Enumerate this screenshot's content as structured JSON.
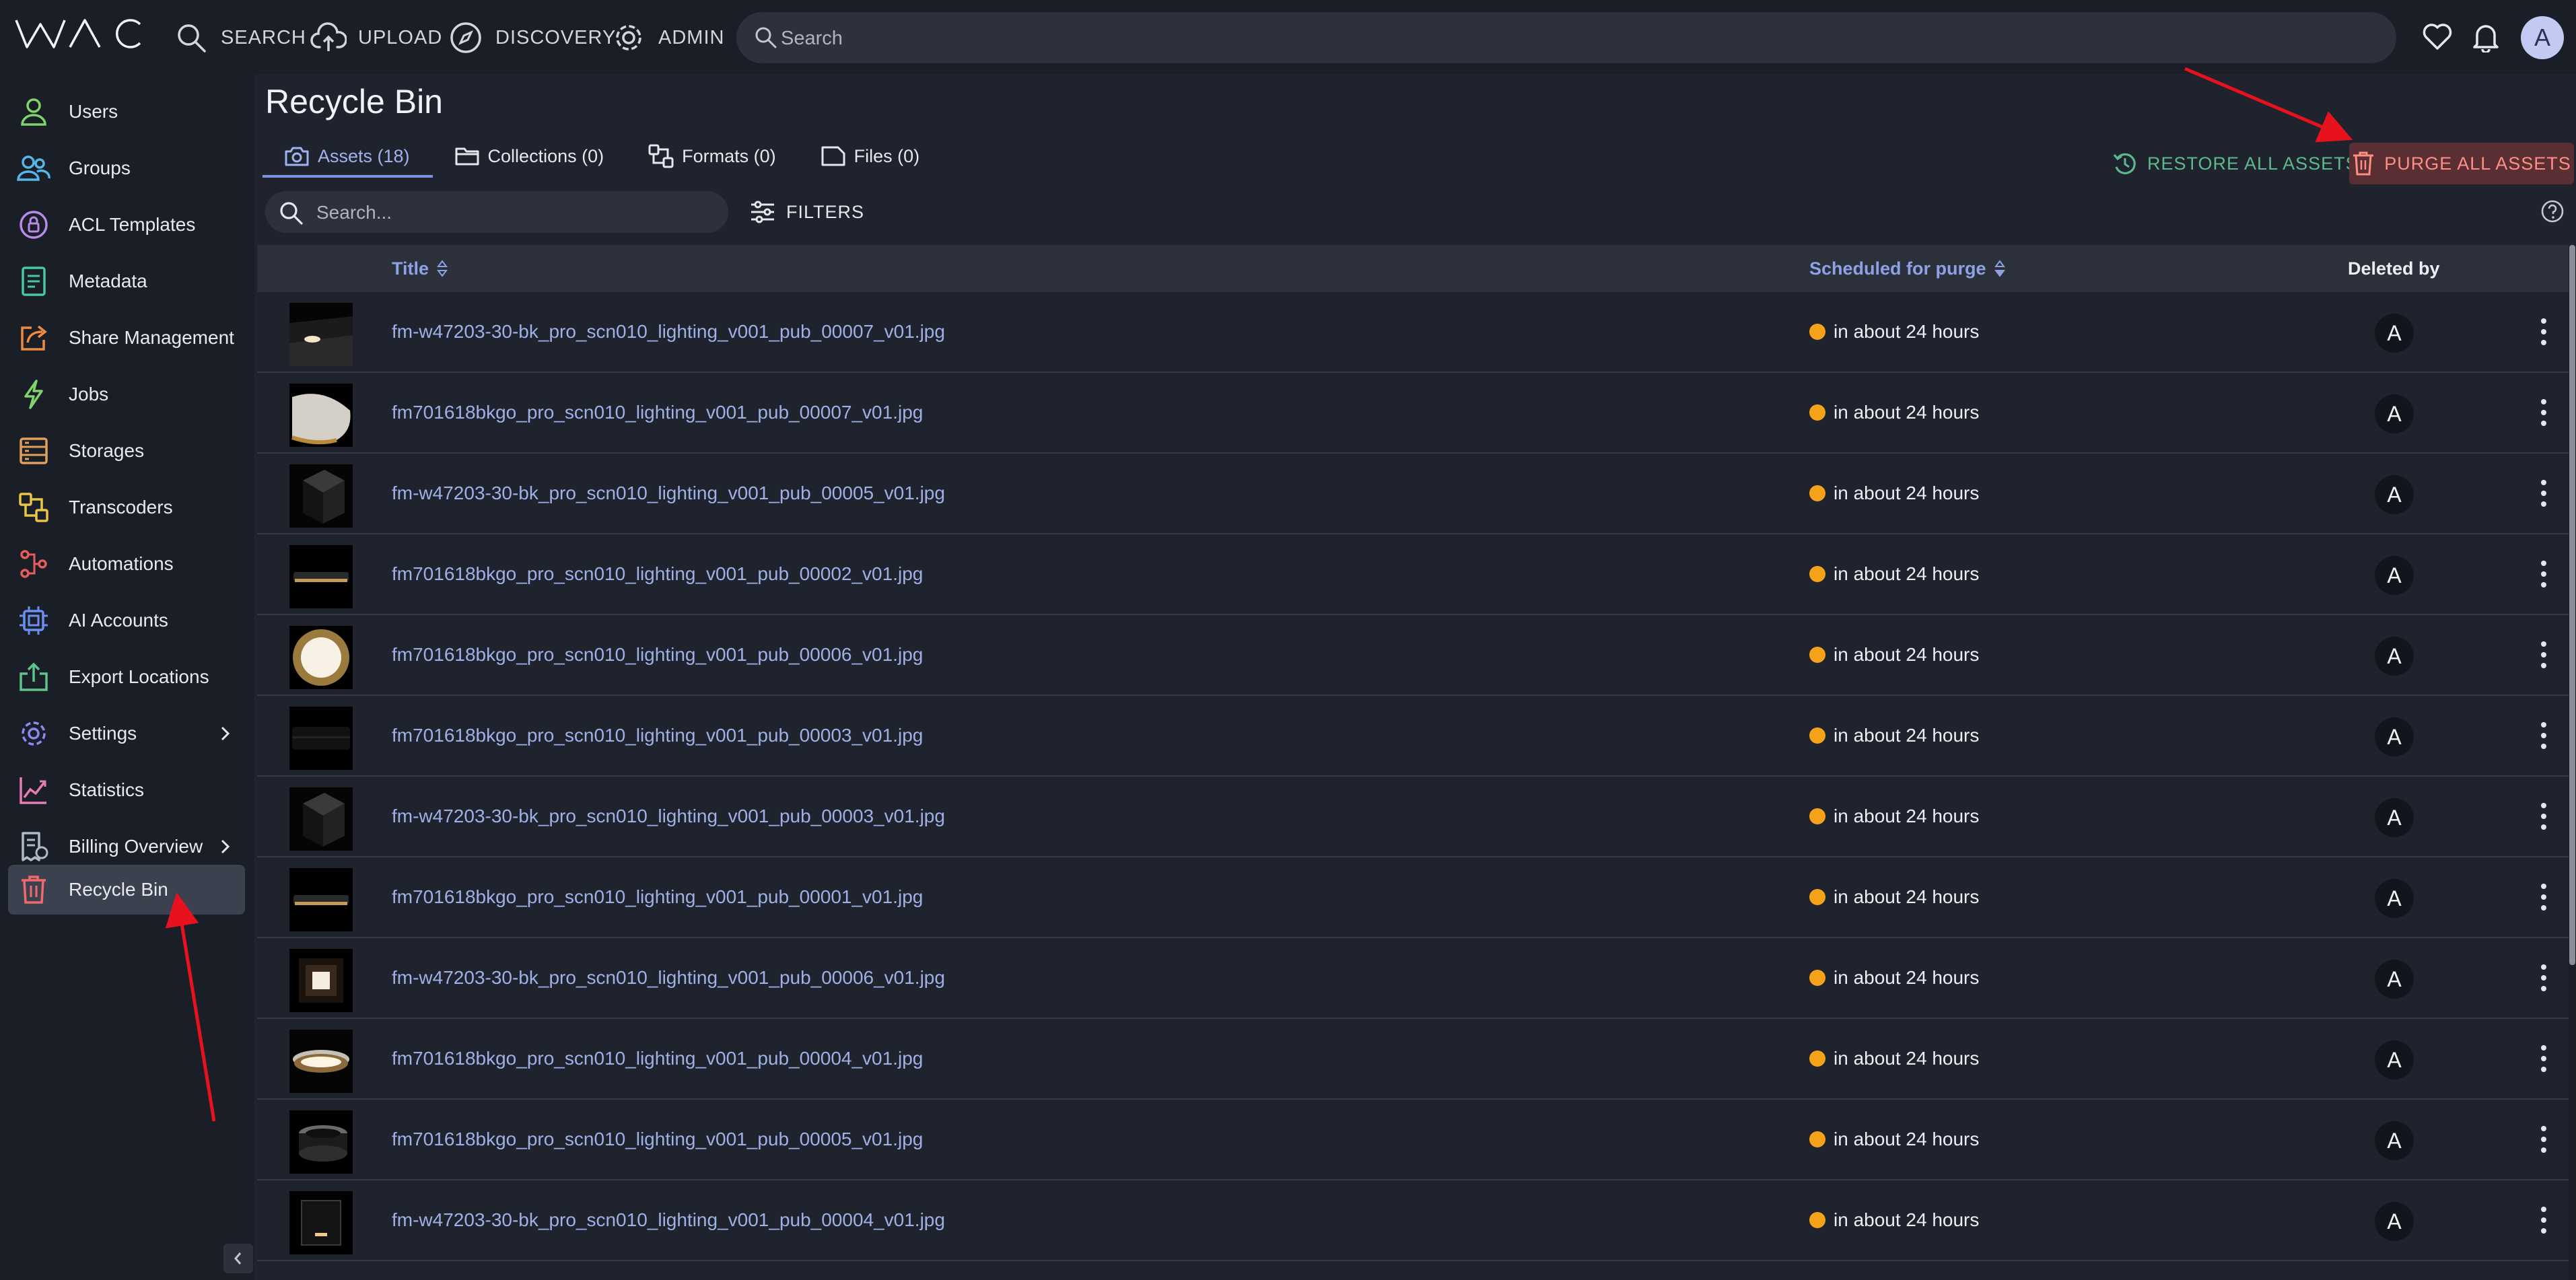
{
  "app": {
    "logo": "WAC"
  },
  "nav": [
    {
      "label": "SEARCH",
      "icon": "search-icon"
    },
    {
      "label": "UPLOAD",
      "icon": "cloud-upload-icon"
    },
    {
      "label": "DISCOVERY",
      "icon": "compass-icon"
    },
    {
      "label": "ADMIN",
      "icon": "gear-icon"
    }
  ],
  "global_search": {
    "placeholder": "Search"
  },
  "user": {
    "initial": "A"
  },
  "sidebar": {
    "items": [
      {
        "label": "Users",
        "icon": "user-icon",
        "color": "#7fd46a"
      },
      {
        "label": "Groups",
        "icon": "group-icon",
        "color": "#55b6e8"
      },
      {
        "label": "ACL Templates",
        "icon": "acl-template-icon",
        "color": "#b98be8"
      },
      {
        "label": "Metadata",
        "icon": "metadata-icon",
        "color": "#49c7a4"
      },
      {
        "label": "Share Management",
        "icon": "share-icon",
        "color": "#f08a3c"
      },
      {
        "label": "Jobs",
        "icon": "lightning-icon",
        "color": "#7fd46a"
      },
      {
        "label": "Storages",
        "icon": "storage-icon",
        "color": "#e0a05a"
      },
      {
        "label": "Transcoders",
        "icon": "transcoder-icon",
        "color": "#e8c54a"
      },
      {
        "label": "Automations",
        "icon": "automation-icon",
        "color": "#e85c5c"
      },
      {
        "label": "AI Accounts",
        "icon": "chip-icon",
        "color": "#6a8ff0"
      },
      {
        "label": "Export Locations",
        "icon": "export-icon",
        "color": "#5dc48a"
      },
      {
        "label": "Settings",
        "icon": "settings-icon",
        "color": "#8f86f0"
      },
      {
        "label": "Statistics",
        "icon": "statistics-icon",
        "color": "#e87ab5"
      },
      {
        "label": "Billing Overview",
        "icon": "billing-icon",
        "color": "#b1b8c8"
      },
      {
        "label": "Recycle Bin",
        "icon": "trash-icon",
        "color": "#ef6a6a"
      }
    ]
  },
  "page": {
    "title": "Recycle Bin"
  },
  "tabs": [
    {
      "label": "Assets (18)",
      "icon": "camera-icon"
    },
    {
      "label": "Collections (0)",
      "icon": "folder-icon"
    },
    {
      "label": "Formats (0)",
      "icon": "formats-icon"
    },
    {
      "label": "Files (0)",
      "icon": "file-icon"
    }
  ],
  "actions": {
    "restore_label": "RESTORE ALL ASSETS",
    "purge_label": "PURGE ALL ASSETS"
  },
  "list_search": {
    "placeholder": "Search..."
  },
  "filters": {
    "label": "FILTERS"
  },
  "table": {
    "columns": {
      "title": "Title",
      "scheduled": "Scheduled for purge",
      "deleted_by": "Deleted by"
    },
    "rows": [
      {
        "title": "fm-w47203-30-bk_pro_scn010_lighting_v001_pub_00007_v01.jpg",
        "scheduled": "in about 24 hours",
        "deleted_by": "A",
        "thumb": "spot"
      },
      {
        "title": "fm701618bkgo_pro_scn010_lighting_v001_pub_00007_v01.jpg",
        "scheduled": "in about 24 hours",
        "deleted_by": "A",
        "thumb": "dome"
      },
      {
        "title": "fm-w47203-30-bk_pro_scn010_lighting_v001_pub_00005_v01.jpg",
        "scheduled": "in about 24 hours",
        "deleted_by": "A",
        "thumb": "cube"
      },
      {
        "title": "fm701618bkgo_pro_scn010_lighting_v001_pub_00002_v01.jpg",
        "scheduled": "in about 24 hours",
        "deleted_by": "A",
        "thumb": "ring"
      },
      {
        "title": "fm701618bkgo_pro_scn010_lighting_v001_pub_00006_v01.jpg",
        "scheduled": "in about 24 hours",
        "deleted_by": "A",
        "thumb": "disc"
      },
      {
        "title": "fm701618bkgo_pro_scn010_lighting_v001_pub_00003_v01.jpg",
        "scheduled": "in about 24 hours",
        "deleted_by": "A",
        "thumb": "darkring"
      },
      {
        "title": "fm-w47203-30-bk_pro_scn010_lighting_v001_pub_00003_v01.jpg",
        "scheduled": "in about 24 hours",
        "deleted_by": "A",
        "thumb": "cube"
      },
      {
        "title": "fm701618bkgo_pro_scn010_lighting_v001_pub_00001_v01.jpg",
        "scheduled": "in about 24 hours",
        "deleted_by": "A",
        "thumb": "ring"
      },
      {
        "title": "fm-w47203-30-bk_pro_scn010_lighting_v001_pub_00006_v01.jpg",
        "scheduled": "in about 24 hours",
        "deleted_by": "A",
        "thumb": "box"
      },
      {
        "title": "fm701618bkgo_pro_scn010_lighting_v001_pub_00004_v01.jpg",
        "scheduled": "in about 24 hours",
        "deleted_by": "A",
        "thumb": "glow"
      },
      {
        "title": "fm701618bkgo_pro_scn010_lighting_v001_pub_00005_v01.jpg",
        "scheduled": "in about 24 hours",
        "deleted_by": "A",
        "thumb": "cylinder"
      },
      {
        "title": "fm-w47203-30-bk_pro_scn010_lighting_v001_pub_00004_v01.jpg",
        "scheduled": "in about 24 hours",
        "deleted_by": "A",
        "thumb": "lamp"
      }
    ]
  },
  "colors": {
    "accent": "#7c92df",
    "purge_text": "#ff8e84",
    "restore_text": "#5db98d",
    "status_dot": "#f6a31b",
    "annotation_arrow": "#e8121e"
  }
}
